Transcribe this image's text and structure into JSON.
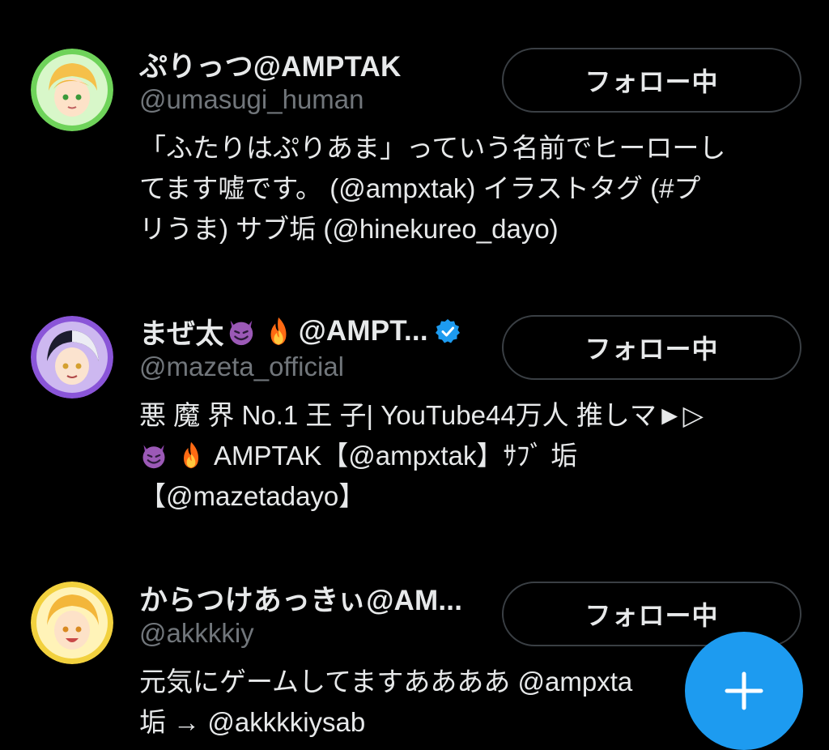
{
  "users": [
    {
      "display_name": "ぷりっつ@AMPTAK",
      "handle": "@umasugi_human",
      "bio_lines": [
        "「ふたりはぷりあま」っていう名前でヒーローし",
        "てます嘘です。 (@ampxtak) イラストタグ (#プ",
        "リうま) サブ垢 (@hinekureo_dayo)"
      ],
      "follow_label": "フォロー中",
      "avatar_color": "#6fd35a"
    },
    {
      "display_name_prefix": "まぜ太",
      "display_name_suffix": "@AMPT...",
      "display_name_emojis": [
        "smiling-devil-emoji",
        "fire-emoji"
      ],
      "verified": true,
      "handle": "@mazeta_official",
      "bio_lines": [
        "悪 魔 界 No.1 王 子| YouTube44万人 推しマ►▷",
        "AMPTAK【@ampxtak】ｻﾌﾞ 垢",
        "【@mazetadayo】"
      ],
      "bio_line2_emojis": [
        "smiling-devil-emoji",
        "fire-emoji"
      ],
      "follow_label": "フォロー中",
      "avatar_color": "#8a55d8"
    },
    {
      "display_name": "からつけあっきぃ@AM...",
      "handle": "@akkkkiy",
      "bio_lines": [
        "元気にゲームしてますああああ @ampxta",
        "垢 → @akkkkiysab"
      ],
      "follow_label": "フォロー中",
      "avatar_color": "#f2d13e"
    }
  ],
  "fab": {
    "icon": "plus-icon",
    "color": "#1d9bf0"
  }
}
